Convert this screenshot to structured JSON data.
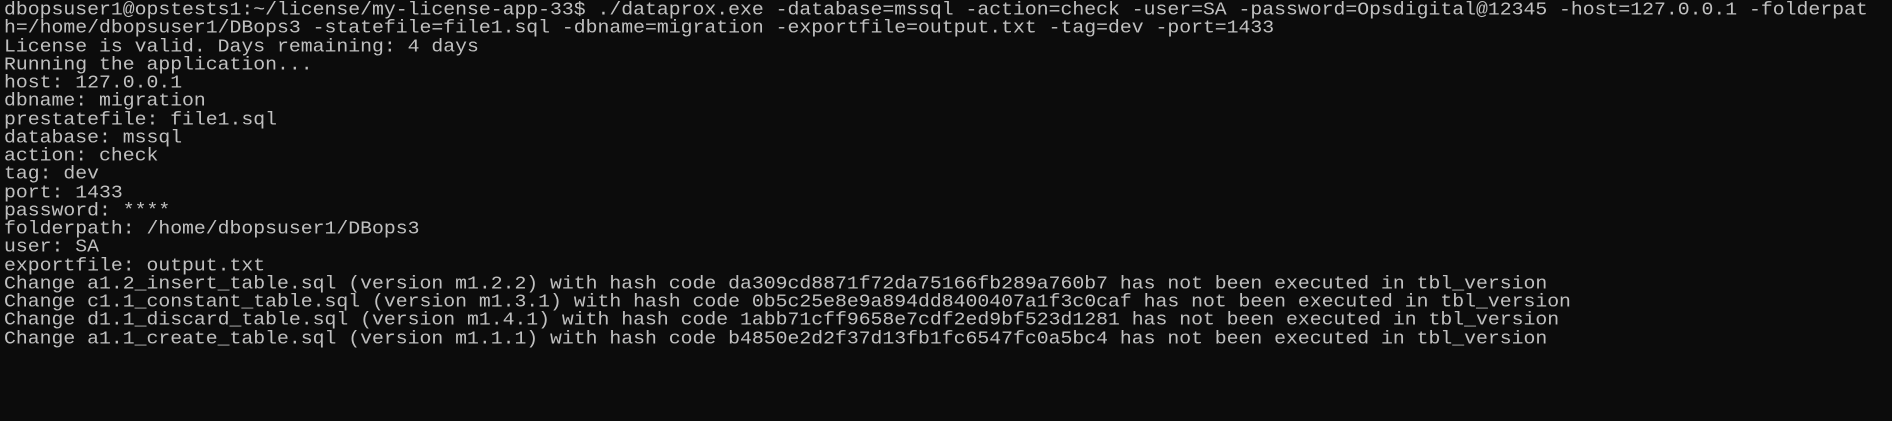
{
  "terminal": {
    "lines": [
      "dbopsuser1@opstests1:~/license/my-license-app-33$ ./dataprox.exe -database=mssql -action=check -user=SA -password=Opsdigital@12345 -host=127.0.0.1 -folderpat",
      "h=/home/dbopsuser1/DBops3 -statefile=file1.sql -dbname=migration -exportfile=output.txt -tag=dev -port=1433",
      "License is valid. Days remaining: 4 days",
      "Running the application...",
      "host: 127.0.0.1",
      "dbname: migration",
      "prestatefile: file1.sql",
      "database: mssql",
      "action: check",
      "tag: dev",
      "port: 1433",
      "password: ****",
      "folderpath: /home/dbopsuser1/DBops3",
      "user: SA",
      "exportfile: output.txt",
      "Change a1.2_insert_table.sql (version m1.2.2) with hash code da309cd8871f72da75166fb289a760b7 has not been executed in tbl_version",
      "Change c1.1_constant_table.sql (version m1.3.1) with hash code 0b5c25e8e9a894dd8400407a1f3c0caf has not been executed in tbl_version",
      "Change d1.1_discard_table.sql (version m1.4.1) with hash code 1abb71cff9658e7cdf2ed9bf523d1281 has not been executed in tbl_version",
      "Change a1.1_create_table.sql (version m1.1.1) with hash code b4850e2d2f37d13fb1fc6547fc0a5bc4 has not been executed in tbl_version"
    ]
  }
}
